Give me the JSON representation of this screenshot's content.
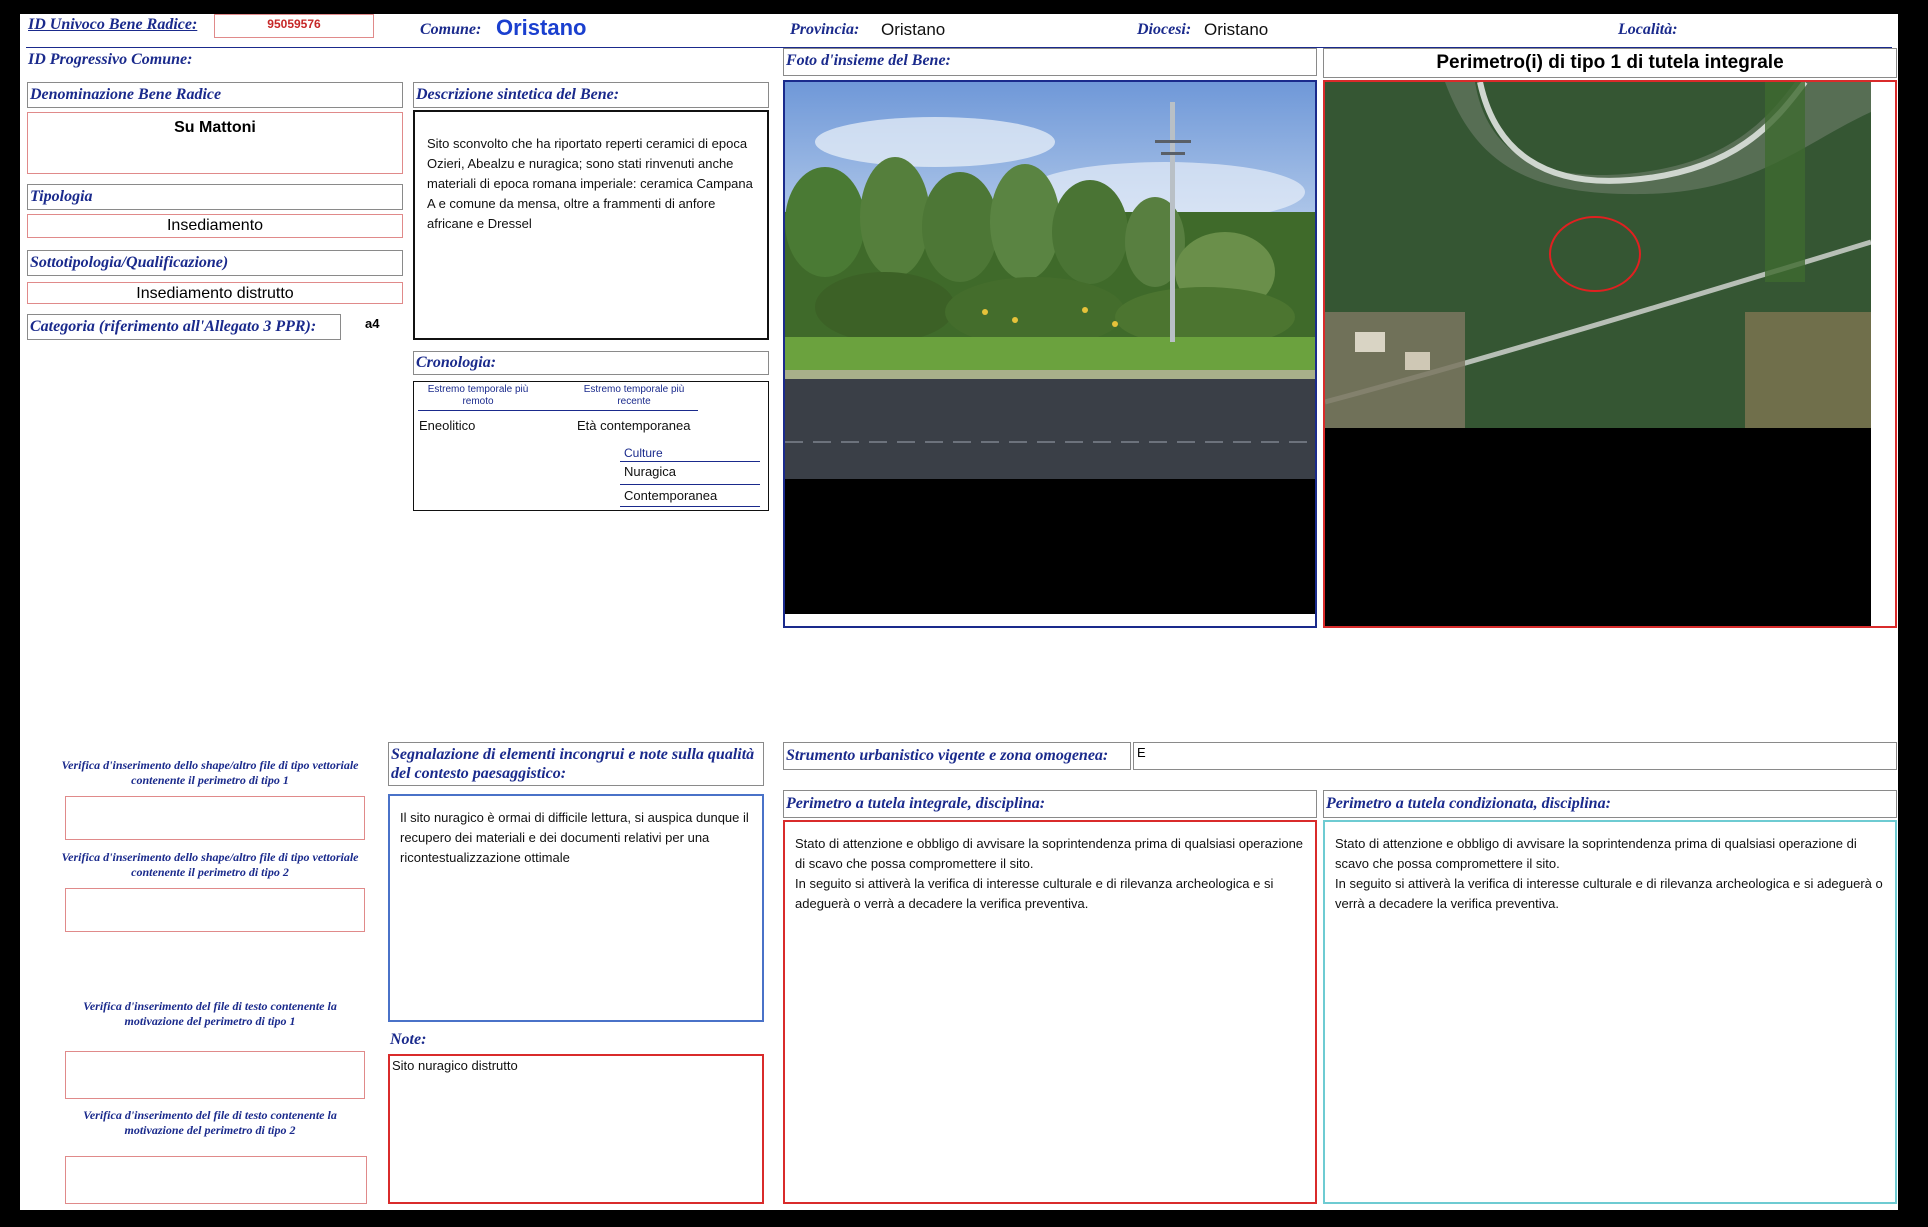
{
  "header": {
    "id_univoco_label": "ID Univoco Bene Radice:",
    "id_univoco_value": "95059576",
    "comune_label": "Comune:",
    "comune_value": "Oristano",
    "provincia_label": "Provincia:",
    "provincia_value": "Oristano",
    "diocesi_label": "Diocesi:",
    "diocesi_value": "Oristano",
    "localita_label": "Località:"
  },
  "left": {
    "id_progressivo_label": "ID Progressivo Comune:",
    "denominazione_label": "Denominazione Bene Radice",
    "denominazione_value": "Su Mattoni",
    "tipologia_label": "Tipologia",
    "tipologia_value": "Insediamento",
    "sottotipologia_label": "Sottotipologia/Qualificazione)",
    "sottotipologia_value": "Insediamento distrutto",
    "categoria_label": "Categoria (riferimento all'Allegato 3 PPR):",
    "categoria_value": "a4"
  },
  "descrizione": {
    "label": "Descrizione sintetica del Bene:",
    "text": "Sito sconvolto che ha riportato reperti ceramici di epoca Ozieri, Abealzu e nuragica; sono stati rinvenuti anche materiali di epoca romana imperiale: ceramica Campana A e comune da mensa, oltre a frammenti di anfore africane e Dressel"
  },
  "cronologia": {
    "label": "Cronologia:",
    "col1_header": "Estremo temporale più remoto",
    "col2_header": "Estremo temporale più recente",
    "remoto": "Eneolitico",
    "recente": "Età contemporanea",
    "culture_header": "Culture",
    "culture": [
      "Nuragica",
      "Contemporanea"
    ]
  },
  "foto": {
    "label": "Foto d'insieme del Bene:"
  },
  "perimetro": {
    "title": "Perimetro(i) di tipo 1 di tutela integrale"
  },
  "verifiche": [
    "Verifica d'inserimento dello shape/altro file di tipo vettoriale contenente il perimetro di tipo 1",
    "Verifica d'inserimento dello shape/altro file di tipo vettoriale contenente il perimetro di tipo 2",
    "Verifica d'inserimento del  file di testo contenente la motivazione del perimetro di tipo 1",
    "Verifica d'inserimento del  file di testo contenente la motivazione del perimetro di tipo 2"
  ],
  "segnalazione": {
    "label": "Segnalazione di elementi incongrui e note sulla qualità del contesto paesaggistico:",
    "text": "Il sito nuragico è ormai di difficile lettura, si auspica dunque il recupero dei materiali e dei documenti relativi per una ricontestualizzazione ottimale"
  },
  "note": {
    "label": "Note:",
    "text": "Sito nuragico distrutto"
  },
  "strumento": {
    "label": "Strumento urbanistico vigente e zona omogenea:",
    "value": "E"
  },
  "tutela_integrale": {
    "label": "Perimetro a tutela integrale, disciplina:",
    "text1": "Stato di attenzione e obbligo di avvisare la soprintendenza prima di qualsiasi operazione di scavo che possa compromettere il sito.",
    "text2": "In seguito si attiverà la verifica di interesse culturale e di rilevanza archeologica e si adeguerà o verrà a decadere la verifica preventiva."
  },
  "tutela_condizionata": {
    "label": "Perimetro a tutela condizionata, disciplina:",
    "text1": "Stato di attenzione e obbligo di avvisare la soprintendenza prima di qualsiasi operazione di scavo che possa compromettere il sito.",
    "text2": "In seguito si attiverà la verifica di interesse culturale e di rilevanza archeologica e si adeguerà o verrà a decadere la verifica preventiva."
  },
  "colors": {
    "label": "#1a2a8c",
    "red_border": "#d92b2b",
    "blue_border": "#4a72c8",
    "teal_border": "#6ecbd2",
    "id_value": "#c62828",
    "comune_value": "#1a3fcf"
  }
}
